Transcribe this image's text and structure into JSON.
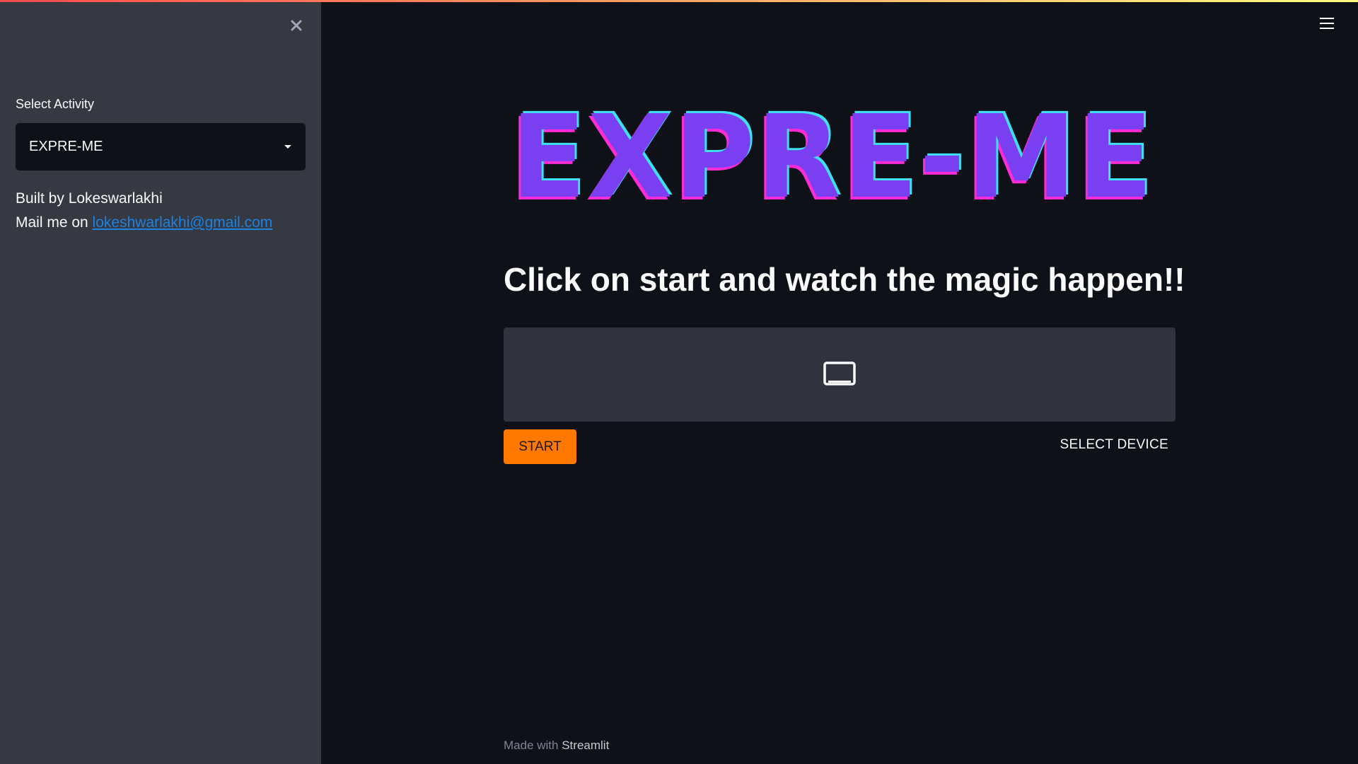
{
  "sidebar": {
    "select_label": "Select Activity",
    "selected_activity": "EXPRE-ME",
    "built_by": "Built by Lokeswarlakhi",
    "mail_prefix": "Mail me on ",
    "email": "lokeshwarlakhi@gmail.com",
    "close_icon": "close-icon"
  },
  "header": {
    "menu_icon": "hamburger-menu-icon"
  },
  "main": {
    "logo_text": "EXPRE-ME",
    "headline": "Click on start and watch the magic happen!!",
    "video_icon": "video-placeholder-icon",
    "start_label": "START",
    "select_device_label": "SELECT DEVICE"
  },
  "footer": {
    "made_with": "Made with",
    "brand": "Streamlit"
  },
  "colors": {
    "app_background": "#0e1117",
    "sidebar_background": "#363842",
    "start_button": "#ff7800",
    "link": "#1c83e1",
    "logo_fill": "#7b3ff2",
    "logo_outline": "#ff2bd6",
    "logo_highlight": "#3de0f5"
  }
}
